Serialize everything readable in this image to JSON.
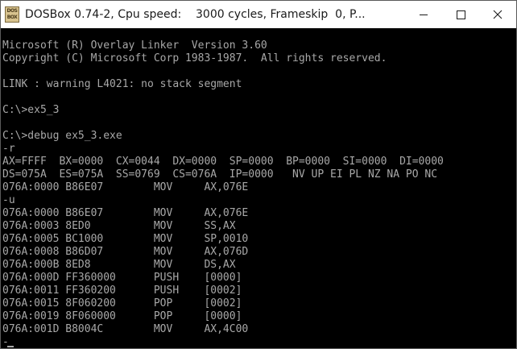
{
  "window": {
    "app": "DOSBox 0.74-2,",
    "speed": "Cpu speed:",
    "cycles": "3000 cycles,",
    "frameskip": "Frameskip  0,",
    "program": "P...",
    "icon_label_top": "DOS",
    "icon_label_bottom": "BOX"
  },
  "title_buttons": [
    "minimize-icon",
    "maximize-icon",
    "close-icon"
  ],
  "colors": {
    "console_bg": "#000000",
    "console_text": "#a8a8a8",
    "titlebar_bg": "#ffffff"
  },
  "console": {
    "lines": [
      "",
      "Microsoft (R) Overlay Linker  Version 3.60",
      "Copyright (C) Microsoft Corp 1983-1987.  All rights reserved.",
      "",
      "LINK : warning L4021: no stack segment",
      "",
      "C:\\>ex5_3",
      "",
      "C:\\>debug ex5_3.exe",
      "-r",
      "AX=FFFF  BX=0000  CX=0044  DX=0000  SP=0000  BP=0000  SI=0000  DI=0000",
      "DS=075A  ES=075A  SS=0769  CS=076A  IP=0000   NV UP EI PL NZ NA PO NC",
      "076A:0000 B86E07        MOV     AX,076E",
      "-u",
      "076A:0000 B86E07        MOV     AX,076E",
      "076A:0003 8ED0          MOV     SS,AX",
      "076A:0005 BC1000        MOV     SP,0010",
      "076A:0008 B86D07        MOV     AX,076D",
      "076A:000B 8ED8          MOV     DS,AX",
      "076A:000D FF360000      PUSH    [0000]",
      "076A:0011 FF360200      PUSH    [0002]",
      "076A:0015 8F060200      POP     [0002]",
      "076A:0019 8F060000      POP     [0000]",
      "076A:001D B8004C        MOV     AX,4C00",
      "-"
    ]
  }
}
